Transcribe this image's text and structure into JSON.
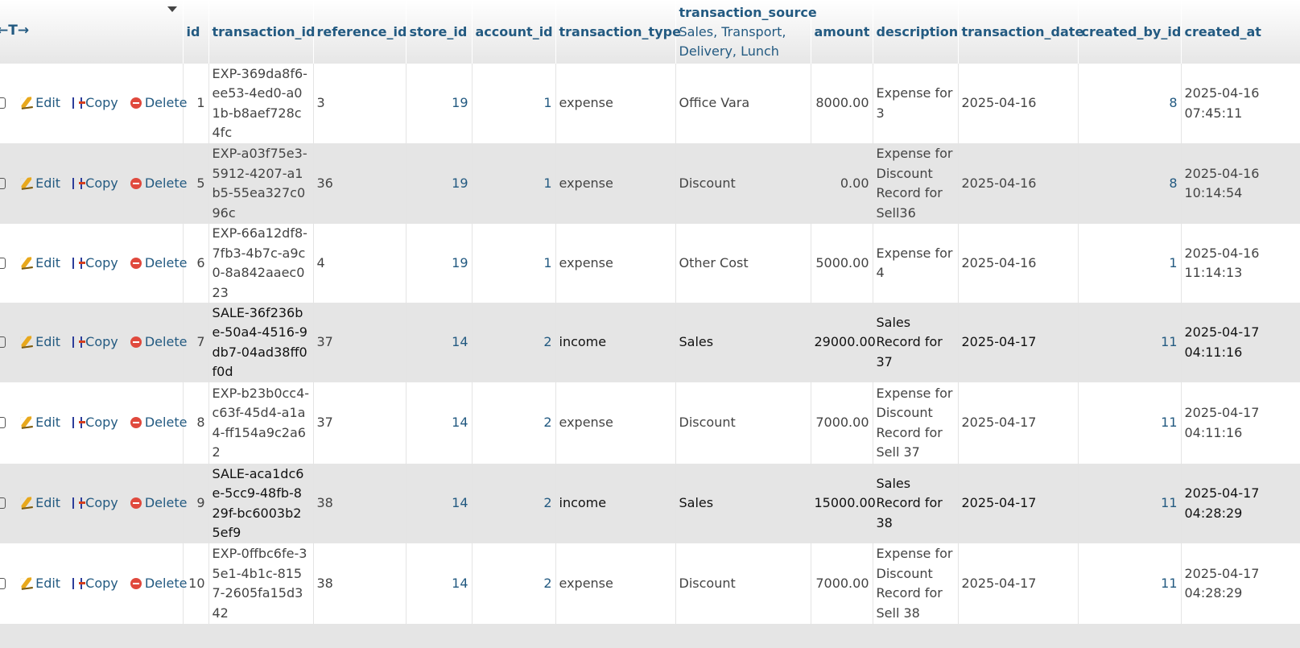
{
  "header": {
    "nav_arrows": "←T→",
    "columns": [
      "id",
      "transaction_id",
      "reference_id",
      "store_id",
      "account_id",
      "transaction_type",
      "transaction_source",
      "amount",
      "description",
      "transaction_date",
      "created_by_id",
      "created_at"
    ],
    "transaction_source_enum": "Sales, Transport, Delivery, Lunch"
  },
  "actions": {
    "edit": "Edit",
    "copy": "Copy",
    "delete": "Delete"
  },
  "rows": [
    {
      "id": "1",
      "transaction_id": "EXP-369da8f6-ee53-4ed0-a01b-b8aef728c4fc",
      "reference_id": "3",
      "store_id": "19",
      "account_id": "1",
      "transaction_type": "expense",
      "transaction_source": "Office Vara",
      "amount": "8000.00",
      "description": "Expense for 3",
      "transaction_date": "2025-04-16",
      "created_by_id": "8",
      "created_at": "2025-04-16 07:45:11"
    },
    {
      "id": "5",
      "transaction_id": "EXP-a03f75e3-5912-4207-a1b5-55ea327c096c",
      "reference_id": "36",
      "store_id": "19",
      "account_id": "1",
      "transaction_type": "expense",
      "transaction_source": "Discount",
      "amount": "0.00",
      "description": "Expense for Discount Record for Sell36",
      "transaction_date": "2025-04-16",
      "created_by_id": "8",
      "created_at": "2025-04-16 10:14:54"
    },
    {
      "id": "6",
      "transaction_id": "EXP-66a12df8-7fb3-4b7c-a9c0-8a842aaec023",
      "reference_id": "4",
      "store_id": "19",
      "account_id": "1",
      "transaction_type": "expense",
      "transaction_source": "Other Cost",
      "amount": "5000.00",
      "description": "Expense for 4",
      "transaction_date": "2025-04-16",
      "created_by_id": "1",
      "created_at": "2025-04-16 11:14:13"
    },
    {
      "id": "7",
      "transaction_id": "SALE-36f236be-50a4-4516-9db7-04ad38ff0f0d",
      "reference_id": "37",
      "store_id": "14",
      "account_id": "2",
      "transaction_type": "income",
      "transaction_source": "Sales",
      "amount": "29000.00",
      "description": "Sales Record for 37",
      "transaction_date": "2025-04-17",
      "created_by_id": "11",
      "created_at": "2025-04-17 04:11:16"
    },
    {
      "id": "8",
      "transaction_id": "EXP-b23b0cc4-c63f-45d4-a1a4-ff154a9c2a62",
      "reference_id": "37",
      "store_id": "14",
      "account_id": "2",
      "transaction_type": "expense",
      "transaction_source": "Discount",
      "amount": "7000.00",
      "description": "Expense for Discount Record for Sell 37",
      "transaction_date": "2025-04-17",
      "created_by_id": "11",
      "created_at": "2025-04-17 04:11:16"
    },
    {
      "id": "9",
      "transaction_id": "SALE-aca1dc6e-5cc9-48fb-829f-bc6003b25ef9",
      "reference_id": "38",
      "store_id": "14",
      "account_id": "2",
      "transaction_type": "income",
      "transaction_source": "Sales",
      "amount": "15000.00",
      "description": "Sales Record for 38",
      "transaction_date": "2025-04-17",
      "created_by_id": "11",
      "created_at": "2025-04-17 04:28:29"
    },
    {
      "id": "10",
      "transaction_id": "EXP-0ffbc6fe-35e1-4b1c-8157-2605fa15d342",
      "reference_id": "38",
      "store_id": "14",
      "account_id": "2",
      "transaction_type": "expense",
      "transaction_source": "Discount",
      "amount": "7000.00",
      "description": "Expense for Discount Record for Sell 38",
      "transaction_date": "2025-04-17",
      "created_by_id": "11",
      "created_at": "2025-04-17 04:28:29"
    }
  ]
}
